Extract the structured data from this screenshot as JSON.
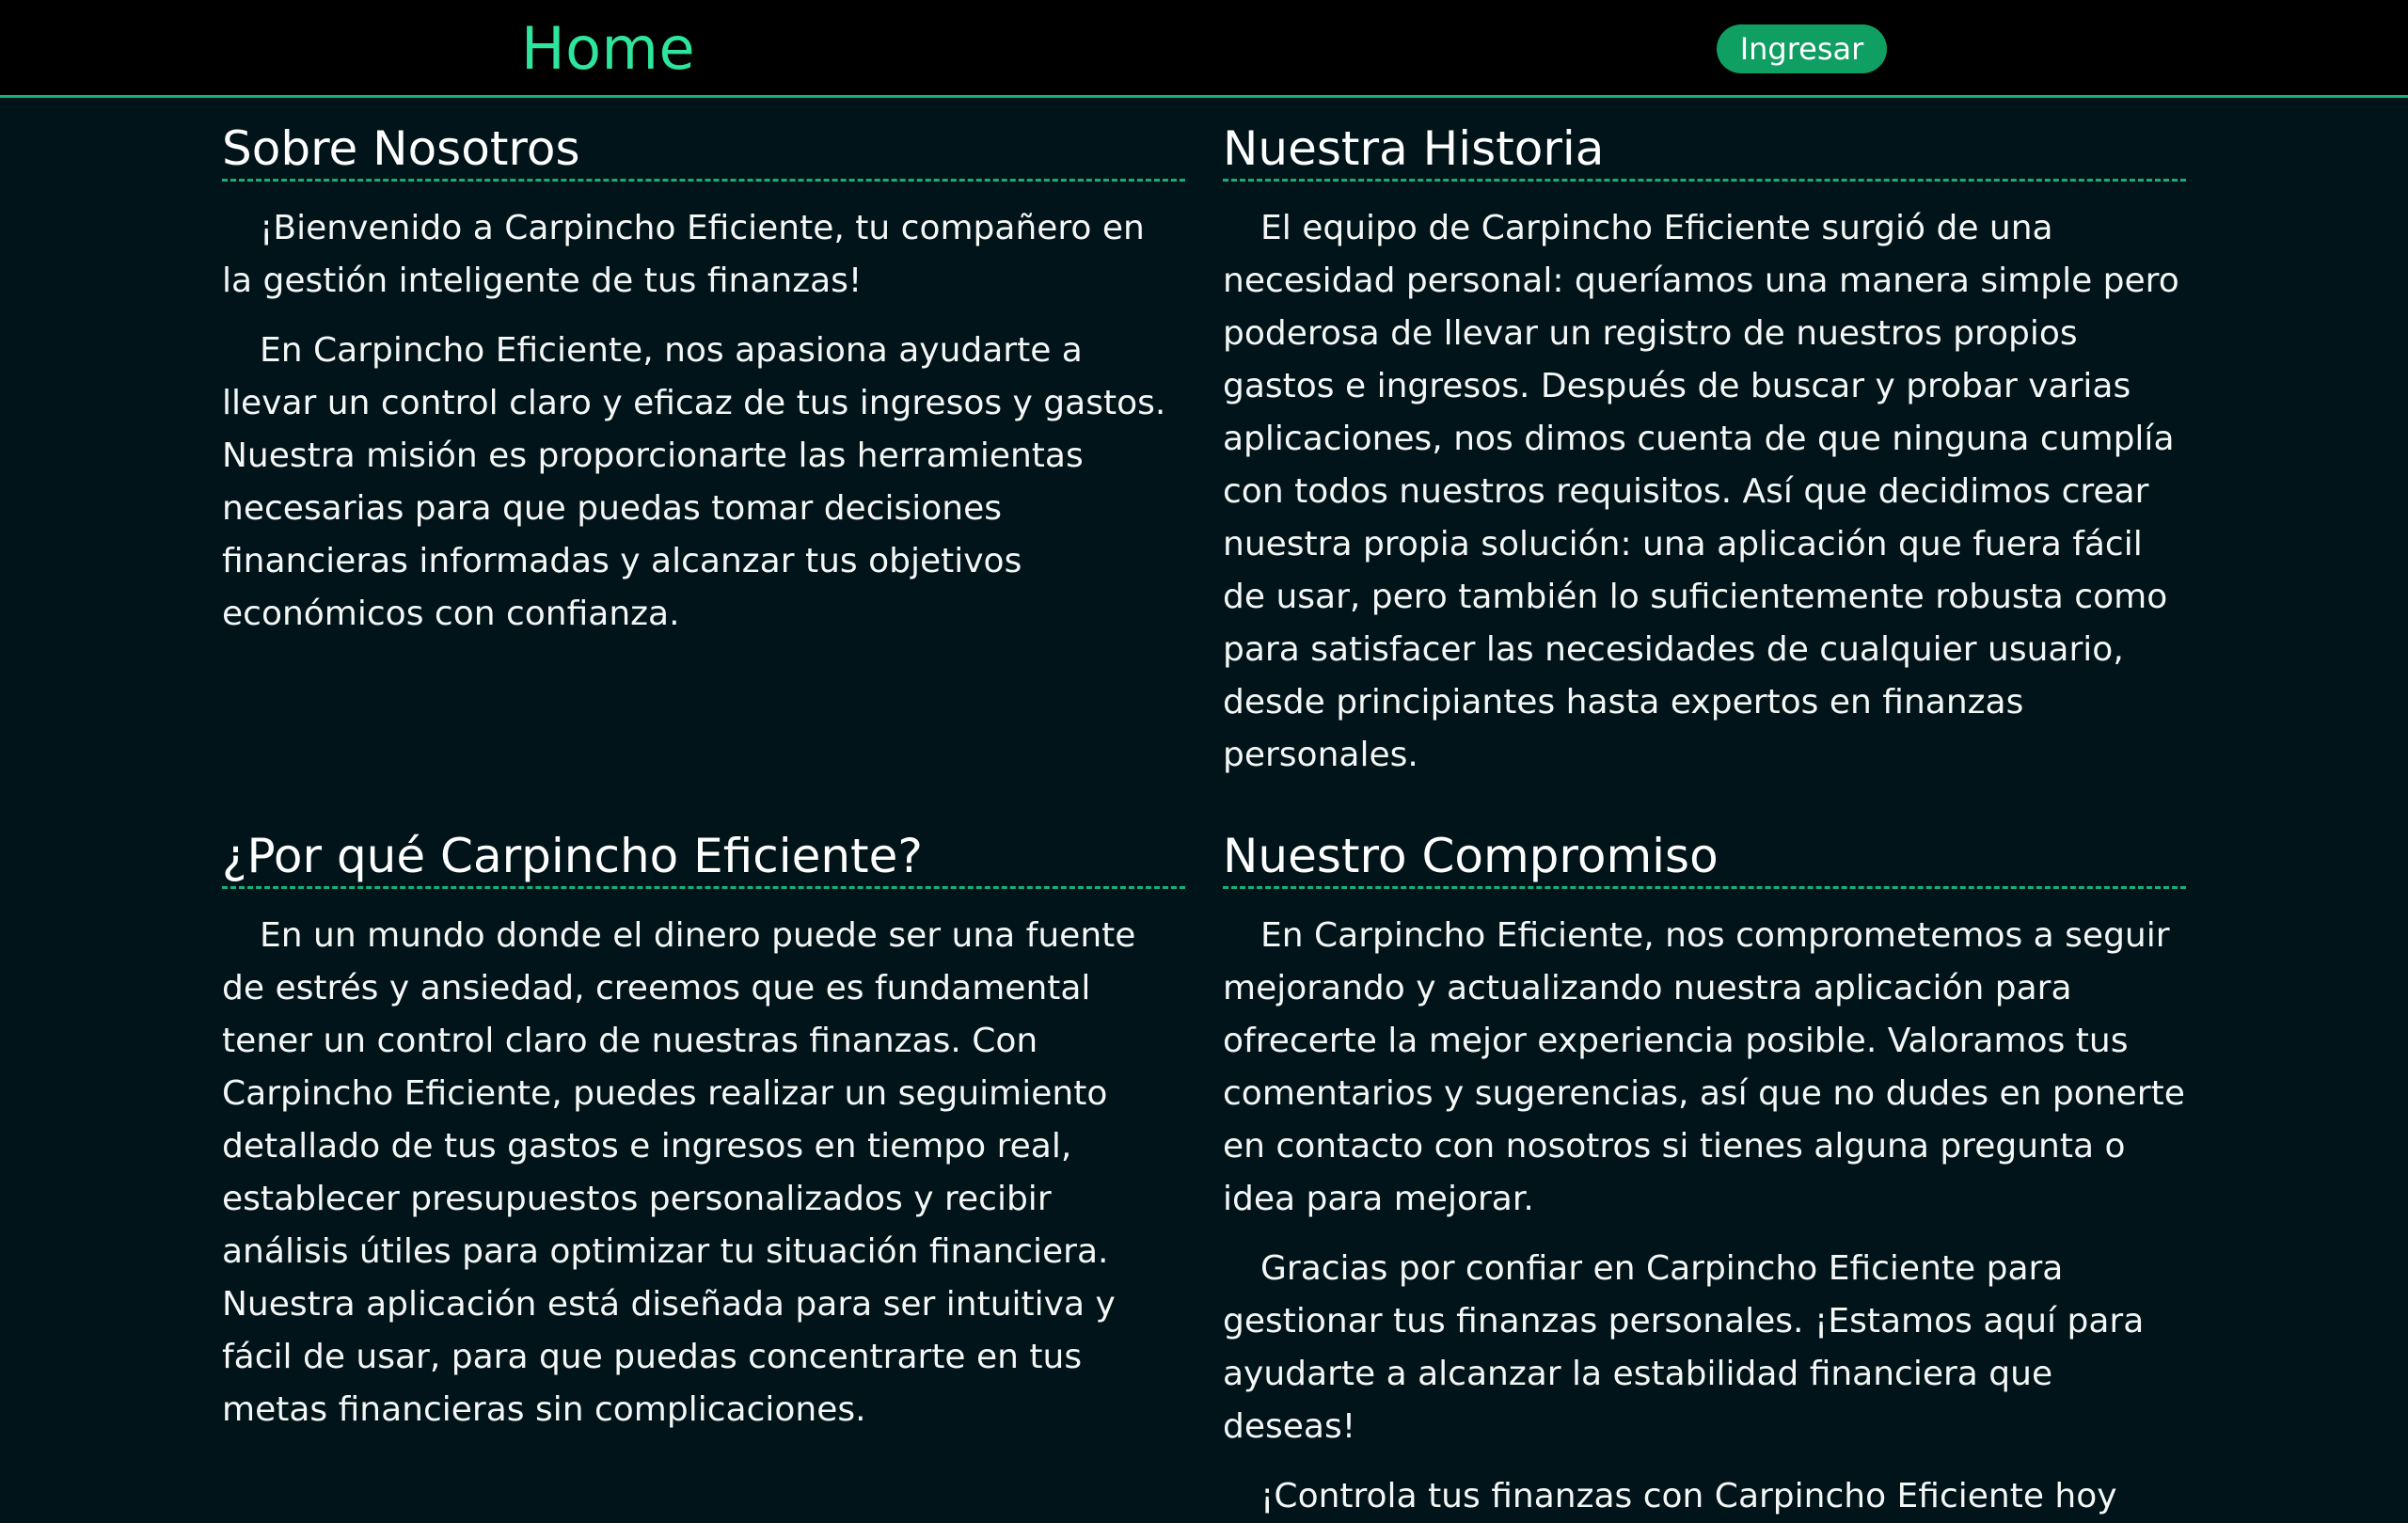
{
  "header": {
    "brand": "Home",
    "login_label": "Ingresar"
  },
  "sections": [
    {
      "title": "Sobre Nosotros",
      "paragraphs": [
        "¡Bienvenido a Carpincho Eficiente, tu compañero en la gestión inteligente de tus finanzas!",
        "En Carpincho Eficiente, nos apasiona ayudarte a llevar un control claro y eficaz de tus ingresos y gastos. Nuestra misión es proporcionarte las herramientas necesarias para que puedas tomar decisiones financieras informadas y alcanzar tus objetivos económicos con confianza."
      ]
    },
    {
      "title": "Nuestra Historia",
      "paragraphs": [
        "El equipo de Carpincho Eficiente surgió de una necesidad personal: queríamos una manera simple pero poderosa de llevar un registro de nuestros propios gastos e ingresos. Después de buscar y probar varias aplicaciones, nos dimos cuenta de que ninguna cumplía con todos nuestros requisitos. Así que decidimos crear nuestra propia solución: una aplicación que fuera fácil de usar, pero también lo suficientemente robusta como para satisfacer las necesidades de cualquier usuario, desde principiantes hasta expertos en finanzas personales."
      ]
    },
    {
      "title": "¿Por qué Carpincho Eficiente?",
      "paragraphs": [
        "En un mundo donde el dinero puede ser una fuente de estrés y ansiedad, creemos que es fundamental tener un control claro de nuestras finanzas. Con Carpincho Eficiente, puedes realizar un seguimiento detallado de tus gastos e ingresos en tiempo real, establecer presupuestos personalizados y recibir análisis útiles para optimizar tu situación financiera. Nuestra aplicación está diseñada para ser intuitiva y fácil de usar, para que puedas concentrarte en tus metas financieras sin complicaciones."
      ]
    },
    {
      "title": "Nuestro Compromiso",
      "paragraphs": [
        "En Carpincho Eficiente, nos comprometemos a seguir mejorando y actualizando nuestra aplicación para ofrecerte la mejor experiencia posible. Valoramos tus comentarios y sugerencias, así que no dudes en ponerte en contacto con nosotros si tienes alguna pregunta o idea para mejorar.",
        "Gracias por confiar en Carpincho Eficiente para gestionar tus finanzas personales. ¡Estamos aquí para ayudarte a alcanzar la estabilidad financiera que deseas!",
        "¡Controla tus finanzas con Carpincho Eficiente hoy"
      ]
    }
  ],
  "colors": {
    "background": "#001419",
    "header_background": "#000000",
    "accent": "#2ee59d",
    "button": "#109f63",
    "divider": "#14b07a"
  }
}
